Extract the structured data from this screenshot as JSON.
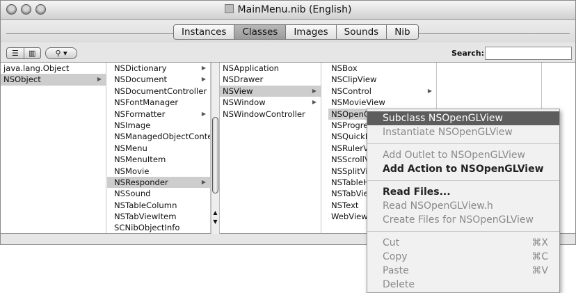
{
  "window": {
    "title": "MainMenu.nib (English)"
  },
  "tabs": [
    {
      "label": "Instances",
      "active": false
    },
    {
      "label": "Classes",
      "active": true
    },
    {
      "label": "Images",
      "active": false
    },
    {
      "label": "Sounds",
      "active": false
    },
    {
      "label": "Nib",
      "active": false
    }
  ],
  "toolbar": {
    "view_list_icon": "list-view-icon",
    "view_column_icon": "column-view-icon",
    "search_menu_icon": "magnifier-icon",
    "search_label": "Search:",
    "search_value": ""
  },
  "columns": [
    {
      "items": [
        {
          "label": "java.lang.Object",
          "arrow": false,
          "selected": false
        },
        {
          "label": "NSObject",
          "arrow": true,
          "selected": true
        }
      ]
    },
    {
      "items": [
        {
          "label": "NSDictionary",
          "arrow": true,
          "selected": false
        },
        {
          "label": "NSDocument",
          "arrow": true,
          "selected": false
        },
        {
          "label": "NSDocumentController",
          "arrow": false,
          "selected": false
        },
        {
          "label": "NSFontManager",
          "arrow": false,
          "selected": false
        },
        {
          "label": "NSFormatter",
          "arrow": true,
          "selected": false
        },
        {
          "label": "NSImage",
          "arrow": false,
          "selected": false
        },
        {
          "label": "NSManagedObjectConte",
          "arrow": false,
          "selected": false
        },
        {
          "label": "NSMenu",
          "arrow": false,
          "selected": false
        },
        {
          "label": "NSMenuItem",
          "arrow": false,
          "selected": false
        },
        {
          "label": "NSMovie",
          "arrow": false,
          "selected": false
        },
        {
          "label": "NSResponder",
          "arrow": true,
          "selected": true
        },
        {
          "label": "NSSound",
          "arrow": false,
          "selected": false
        },
        {
          "label": "NSTableColumn",
          "arrow": false,
          "selected": false
        },
        {
          "label": "NSTabViewItem",
          "arrow": false,
          "selected": false
        },
        {
          "label": "SCNibObjectInfo",
          "arrow": false,
          "selected": false
        }
      ]
    },
    {
      "items": [
        {
          "label": "NSApplication",
          "arrow": false,
          "selected": false
        },
        {
          "label": "NSDrawer",
          "arrow": false,
          "selected": false
        },
        {
          "label": "NSView",
          "arrow": true,
          "selected": true
        },
        {
          "label": "NSWindow",
          "arrow": true,
          "selected": false
        },
        {
          "label": "NSWindowController",
          "arrow": false,
          "selected": false
        }
      ]
    },
    {
      "items": [
        {
          "label": "NSBox",
          "arrow": false,
          "selected": false
        },
        {
          "label": "NSClipView",
          "arrow": false,
          "selected": false
        },
        {
          "label": "NSControl",
          "arrow": true,
          "selected": false
        },
        {
          "label": "NSMovieView",
          "arrow": false,
          "selected": false
        },
        {
          "label": "NSOpenGLView",
          "arrow": false,
          "selected": true
        },
        {
          "label": "NSProgre",
          "arrow": false,
          "selected": false
        },
        {
          "label": "NSQuickD",
          "arrow": false,
          "selected": false
        },
        {
          "label": "NSRulerVi",
          "arrow": false,
          "selected": false
        },
        {
          "label": "NSScrollV",
          "arrow": false,
          "selected": false
        },
        {
          "label": "NSSplitVi",
          "arrow": false,
          "selected": false
        },
        {
          "label": "NSTableH",
          "arrow": false,
          "selected": false
        },
        {
          "label": "NSTabVie",
          "arrow": false,
          "selected": false
        },
        {
          "label": "NSText",
          "arrow": false,
          "selected": false
        },
        {
          "label": "WebView",
          "arrow": false,
          "selected": false
        }
      ]
    },
    {
      "items": []
    }
  ],
  "context_menu": {
    "groups": [
      [
        {
          "label": "Subclass NSOpenGLView",
          "state": "highlighted",
          "shortcut": ""
        },
        {
          "label": "Instantiate NSOpenGLView",
          "state": "disabled",
          "shortcut": ""
        }
      ],
      [
        {
          "label": "Add Outlet to NSOpenGLView",
          "state": "disabled",
          "shortcut": ""
        },
        {
          "label": "Add Action to NSOpenGLView",
          "state": "bold",
          "shortcut": ""
        }
      ],
      [
        {
          "label": "Read Files...",
          "state": "bold",
          "shortcut": ""
        },
        {
          "label": "Read NSOpenGLView.h",
          "state": "disabled",
          "shortcut": ""
        },
        {
          "label": "Create Files for NSOpenGLView",
          "state": "disabled",
          "shortcut": ""
        }
      ],
      [
        {
          "label": "Cut",
          "state": "disabled",
          "shortcut": "⌘X"
        },
        {
          "label": "Copy",
          "state": "disabled",
          "shortcut": "⌘C"
        },
        {
          "label": "Paste",
          "state": "disabled",
          "shortcut": "⌘V"
        },
        {
          "label": "Delete",
          "state": "disabled",
          "shortcut": ""
        }
      ]
    ]
  }
}
